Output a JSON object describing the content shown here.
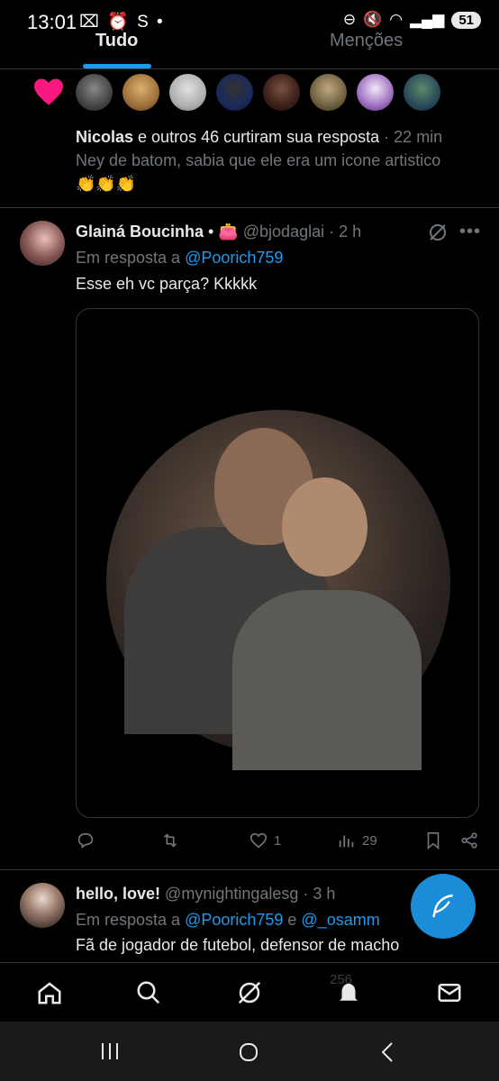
{
  "status_bar": {
    "time": "13:01",
    "left_icons": "⌧ ⏰ S •",
    "battery": "51"
  },
  "tabs": [
    {
      "label": "Tudo",
      "active": true
    },
    {
      "label": "Menções",
      "active": false
    }
  ],
  "colors": {
    "accent": "#1d9bf0",
    "like": "#f91880",
    "background": "#000000",
    "muted": "#71767b"
  },
  "notification": {
    "actor": "Nicolas",
    "text": " e outros 46 curtiram sua resposta",
    "time": " · 22 min",
    "preview": "Ney de batom, sabia que ele era um icone artistico",
    "emojis": "👏👏👏",
    "avatar_count": 8
  },
  "tweet1": {
    "name": "Glainá Boucinha",
    "badge": " • 👛",
    "handle": "@bjodaglai",
    "time": " · 2 h",
    "reply_prefix": "Em resposta a ",
    "reply_to": "@Poorich759",
    "text": "Esse eh vc parça? Kkkkk",
    "likes": "1",
    "views": "29"
  },
  "tweet2": {
    "name": "hello, love!",
    "handle": "@mynightingalesg",
    "time": " · 3 h",
    "reply_prefix": "Em resposta a ",
    "reply_to": "@Poorich759",
    "reply_joiner": " e ",
    "reply_to2": "@_osamm",
    "text": "Fã de jogador de futebol, defensor de macho",
    "views": "256"
  },
  "bottom_nav": [
    "home-icon",
    "search-icon",
    "grok-icon",
    "notifications-icon",
    "messages-icon"
  ],
  "system_nav": [
    "recents-icon",
    "home-circle-icon",
    "back-icon"
  ]
}
